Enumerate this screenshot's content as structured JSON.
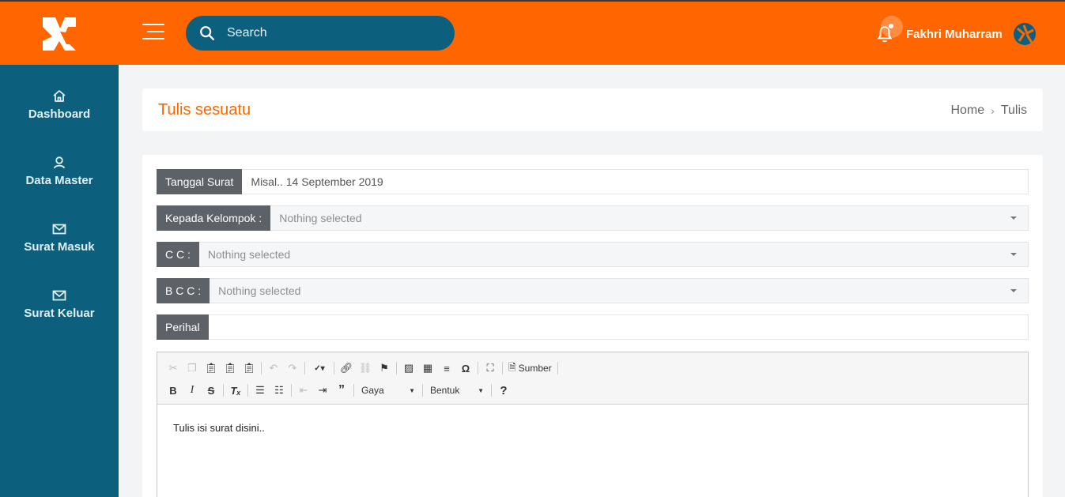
{
  "header": {
    "search_placeholder": "Search",
    "user_name": "Fakhri Muharram"
  },
  "sidebar": {
    "items": [
      {
        "label": "Dashboard",
        "icon": "home-icon"
      },
      {
        "label": "Data Master",
        "icon": "user-icon"
      },
      {
        "label": "Surat Masuk",
        "icon": "mail-icon"
      },
      {
        "label": "Surat Keluar",
        "icon": "mail-icon"
      }
    ]
  },
  "page": {
    "title": "Tulis sesuatu",
    "breadcrumb": [
      "Home",
      "Tulis"
    ]
  },
  "form": {
    "tanggal_label": "Tanggal Surat",
    "tanggal_placeholder": "Misal.. 14 September 2019",
    "kepada_label": "Kepada Kelompok :",
    "kepada_value": "Nothing selected",
    "cc_label": "C C :",
    "cc_value": "Nothing selected",
    "bcc_label": "B C C :",
    "bcc_value": "Nothing selected",
    "perihal_label": "Perihal",
    "perihal_value": ""
  },
  "editor": {
    "gaya_label": "Gaya",
    "bentuk_label": "Bentuk",
    "sumber_label": "Sumber",
    "body_text": "Tulis isi surat disini.."
  },
  "colors": {
    "accent": "#ff6600",
    "sidebar": "#0d5f7e",
    "addon": "#5d6269"
  }
}
